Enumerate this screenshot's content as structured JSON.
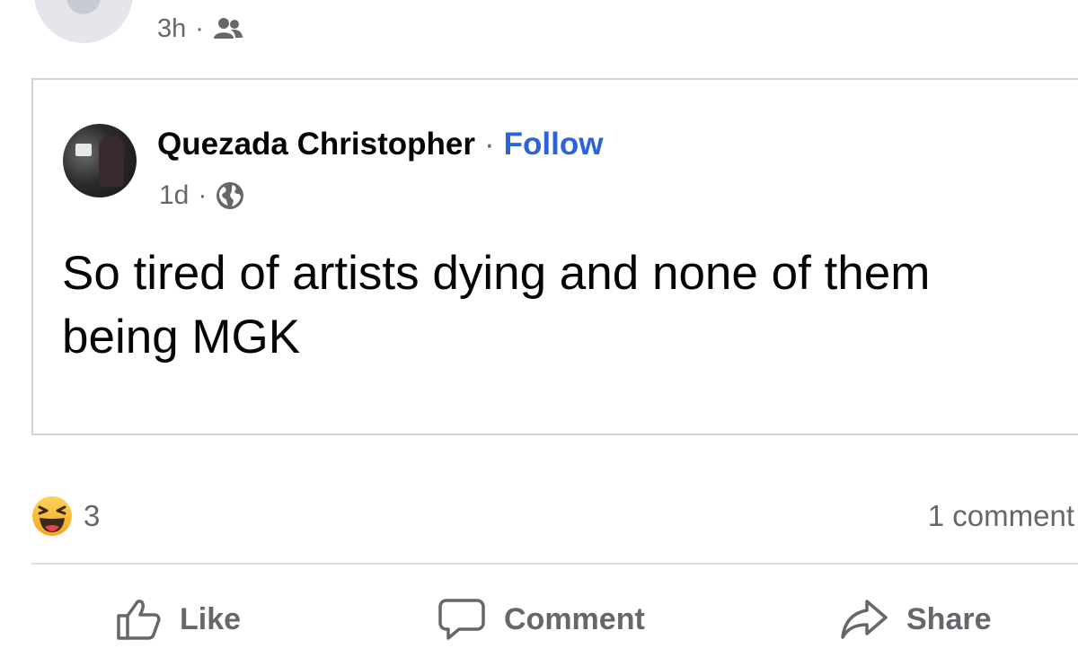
{
  "outer_post": {
    "time": "3h",
    "separator": "·",
    "audience_icon": "friends-icon"
  },
  "shared_post": {
    "author": "Quezada Christopher",
    "separator": "·",
    "follow_label": "Follow",
    "time": "1d",
    "audience_icon": "globe-icon",
    "text": "So tired of artists dying and none of them being MGK"
  },
  "reactions": {
    "icon": "haha-icon",
    "count": "3",
    "comments": "1 comment"
  },
  "actions": {
    "like_label": "Like",
    "comment_label": "Comment",
    "share_label": "Share"
  },
  "colors": {
    "link_blue": "#2d63d8",
    "meta_gray": "#65676b",
    "haha_yellow": "#f7b125"
  }
}
